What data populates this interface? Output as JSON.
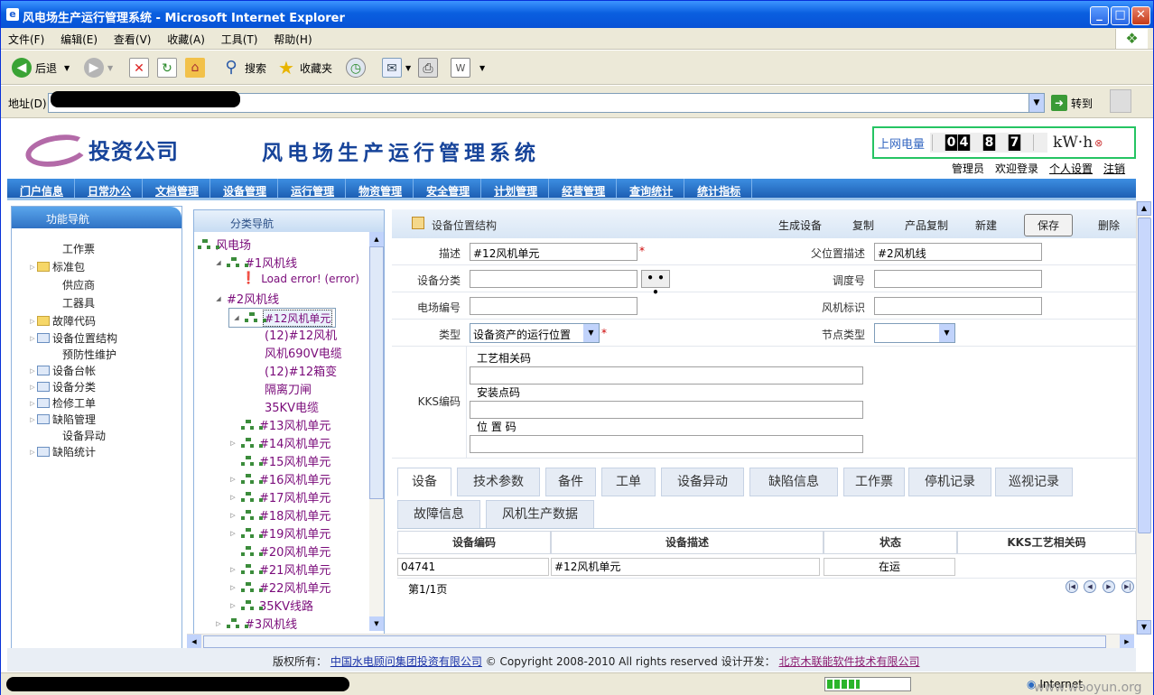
{
  "window": {
    "title": "风电场生产运行管理系统 - Microsoft Internet Explorer"
  },
  "menu": [
    "文件(F)",
    "编辑(E)",
    "查看(V)",
    "收藏(A)",
    "工具(T)",
    "帮助(H)"
  ],
  "toolbar": {
    "back": "后退",
    "search": "搜索",
    "favorites": "收藏夹"
  },
  "address": {
    "label": "地址(D)",
    "go": "转到"
  },
  "banner": {
    "company": "投资公司",
    "title": "风电场生产运行管理系统",
    "meter_label": "上网电量",
    "digits": [
      "",
      "0",
      "4",
      "",
      "8",
      "",
      "7",
      "",
      ""
    ],
    "unit": "kW·h"
  },
  "user": {
    "role": "管理员",
    "welcome": "欢迎登录",
    "settings": "个人设置",
    "logout": "注销"
  },
  "nav": [
    "门户信息",
    "日常办公",
    "文档管理",
    "设备管理",
    "运行管理",
    "物资管理",
    "安全管理",
    "计划管理",
    "经营管理",
    "查询统计",
    "统计指标"
  ],
  "leftnav": {
    "title": "功能导航",
    "items": [
      {
        "label": "工作票",
        "exp": false,
        "icon": "none"
      },
      {
        "label": "标准包",
        "exp": true,
        "icon": "folder"
      },
      {
        "label": "供应商",
        "exp": false,
        "icon": "none"
      },
      {
        "label": "工器具",
        "exp": false,
        "icon": "none"
      },
      {
        "label": "故障代码",
        "exp": true,
        "icon": "folder"
      },
      {
        "label": "设备位置结构",
        "exp": true,
        "icon": "grid"
      },
      {
        "label": "预防性维护",
        "exp": false,
        "icon": "none"
      },
      {
        "label": "设备台帐",
        "exp": true,
        "icon": "grid"
      },
      {
        "label": "设备分类",
        "exp": true,
        "icon": "grid"
      },
      {
        "label": "检修工单",
        "exp": true,
        "icon": "grid"
      },
      {
        "label": "缺陷管理",
        "exp": true,
        "icon": "grid"
      },
      {
        "label": "设备异动",
        "exp": false,
        "icon": "none"
      },
      {
        "label": "缺陷统计",
        "exp": true,
        "icon": "grid"
      }
    ]
  },
  "classnav": {
    "title": "分类导航",
    "nodes": [
      {
        "label": "风电场",
        "lvl": 0,
        "ex": "",
        "icon": true
      },
      {
        "label": "#1风机线",
        "lvl": 1,
        "ex": "◢",
        "icon": true
      },
      {
        "label": "Load error! (error)",
        "lvl": 2,
        "ex": "",
        "icon": false,
        "err": true
      },
      {
        "label": "#2风机线",
        "lvl": 1,
        "ex": "◢",
        "icon": false
      },
      {
        "label": "#12风机单元",
        "lvl": 2,
        "ex": "◢",
        "icon": true,
        "sel": true
      },
      {
        "label": "(12)#12风机",
        "lvl": 3,
        "ex": "",
        "icon": false
      },
      {
        "label": "风机690V电缆",
        "lvl": 3,
        "ex": "",
        "icon": false
      },
      {
        "label": "(12)#12箱变",
        "lvl": 3,
        "ex": "",
        "icon": false
      },
      {
        "label": "隔离刀闸",
        "lvl": 3,
        "ex": "",
        "icon": false
      },
      {
        "label": "35KV电缆",
        "lvl": 3,
        "ex": "",
        "icon": false
      },
      {
        "label": "#13风机单元",
        "lvl": 2,
        "ex": "",
        "icon": true
      },
      {
        "label": "#14风机单元",
        "lvl": 2,
        "ex": "▷",
        "icon": true
      },
      {
        "label": "#15风机单元",
        "lvl": 2,
        "ex": "",
        "icon": true
      },
      {
        "label": "#16风机单元",
        "lvl": 2,
        "ex": "▷",
        "icon": true
      },
      {
        "label": "#17风机单元",
        "lvl": 2,
        "ex": "▷",
        "icon": true
      },
      {
        "label": "#18风机单元",
        "lvl": 2,
        "ex": "▷",
        "icon": true
      },
      {
        "label": "#19风机单元",
        "lvl": 2,
        "ex": "▷",
        "icon": true
      },
      {
        "label": "#20风机单元",
        "lvl": 2,
        "ex": "",
        "icon": true
      },
      {
        "label": "#21风机单元",
        "lvl": 2,
        "ex": "▷",
        "icon": true
      },
      {
        "label": "#22风机单元",
        "lvl": 2,
        "ex": "▷",
        "icon": true
      },
      {
        "label": "35KV线路",
        "lvl": 2,
        "ex": "▷",
        "icon": true
      },
      {
        "label": "#3风机线",
        "lvl": 1,
        "ex": "▷",
        "icon": true
      }
    ]
  },
  "form": {
    "title": "设备位置结构",
    "actions": {
      "gen": "生成设备",
      "copy": "复制",
      "pcopy": "产品复制",
      "new": "新建",
      "save": "保存",
      "del": "删除"
    },
    "desc_label": "描述",
    "desc_value": "#12风机单元",
    "parent_label": "父位置描述",
    "parent_value": "#2风机线",
    "cat_label": "设备分类",
    "cat_value": "",
    "dots": "• • •",
    "dispatch_label": "调度号",
    "dispatch_value": "",
    "plant_label": "电场编号",
    "plant_value": "",
    "fan_label": "风机标识",
    "fan_value": "",
    "type_label": "类型",
    "type_value": "设备资产的运行位置",
    "node_label": "节点类型",
    "node_value": "",
    "kks_label": "KKS编码",
    "kks1_label": "工艺相关码",
    "kks2_label": "安装点码",
    "kks3_label": "位 置 码",
    "req": "*"
  },
  "tabs": [
    "设备",
    "技术参数",
    "备件",
    "工单",
    "设备异动",
    "缺陷信息",
    "工作票",
    "停机记录",
    "巡视记录",
    "故障信息",
    "风机生产数据"
  ],
  "grid": {
    "headers": [
      "设备编码",
      "设备描述",
      "状态",
      "KKS工艺相关码"
    ],
    "row": [
      "04741",
      "#12风机单元",
      "在运",
      ""
    ],
    "pager": "第1/1页"
  },
  "footer": {
    "copyright": "版权所有：",
    "org": "中国水电顾问集团投资有限公司",
    "rights": "© Copyright 2008-2010 All rights reserved 设计开发：",
    "dev": "北京木联能软件技术有限公司"
  },
  "status": {
    "zone": "Internet",
    "watermark": "www.wooyun.org"
  }
}
